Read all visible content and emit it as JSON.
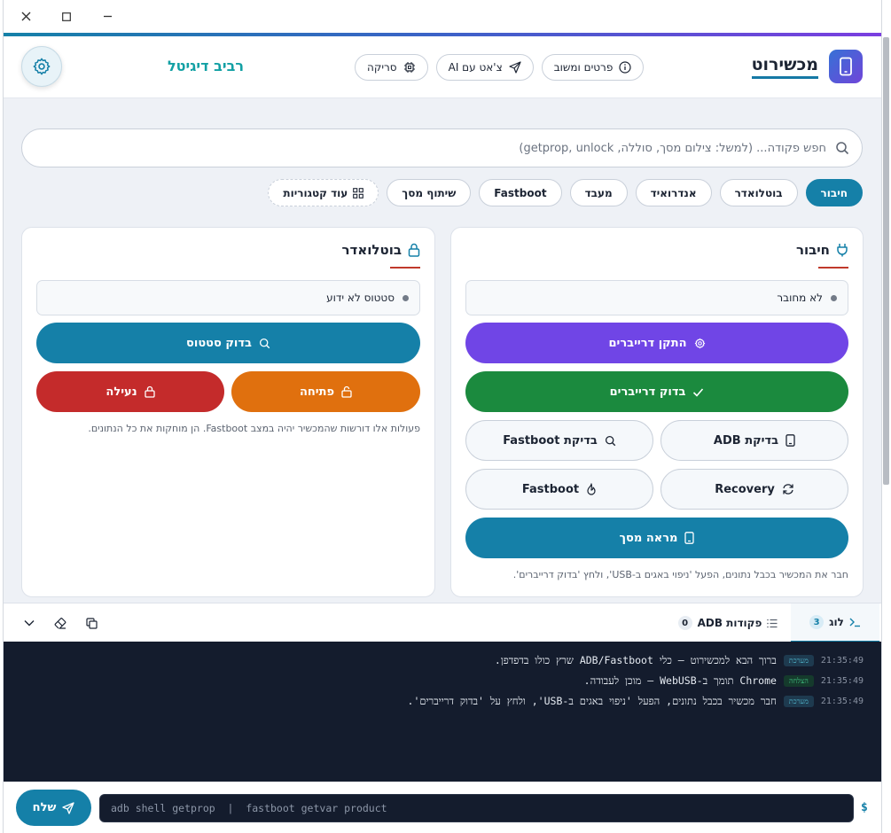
{
  "window": {
    "controls": {
      "close": "×",
      "maximize": "□",
      "minimize": "–"
    }
  },
  "header": {
    "brand_title": "מכשירוט",
    "subtitle": "רביב דיגיטל",
    "buttons": [
      {
        "label": "פרטים ומשוב",
        "icon": "info-icon"
      },
      {
        "label": "צ'אט עם AI",
        "icon": "send-icon"
      },
      {
        "label": "סריקה",
        "icon": "chip-icon"
      }
    ]
  },
  "search": {
    "placeholder": "חפש פקודה... (למשל: צילום מסך, סוללה, getprop, unlock)"
  },
  "categories": {
    "items": [
      "חיבור",
      "בוטלואדר",
      "אנדרואיד",
      "מעבד",
      "Fastboot",
      "שיתוף מסך"
    ],
    "active": "חיבור",
    "more_label": "עוד קטגוריות"
  },
  "connection_panel": {
    "title": "חיבור",
    "status": "לא מחובר",
    "install_drivers": "התקן דרייברים",
    "check_drivers": "בדוק דרייברים",
    "adb_check": "בדיקת ADB",
    "fastboot_check": "בדיקת Fastboot",
    "recovery": "Recovery",
    "fastboot": "Fastboot",
    "screen_mirror": "מראה מסך",
    "note": "חבר את המכשיר בכבל נתונים, הפעל 'ניפוי באגים ב-USB', ולחץ 'בדוק דרייברים'."
  },
  "bootloader_panel": {
    "title": "בוטלואדר",
    "status": "סטטוס לא ידוע",
    "check_status": "בדוק סטטוס",
    "unlock": "פתיחה",
    "lock": "נעילה",
    "note": "פעולות אלו דורשות שהמכשיר יהיה במצב Fastboot. הן מוחקות את כל הנתונים."
  },
  "terminal": {
    "log_tab": "לוג",
    "log_count": "3",
    "adb_tab": "פקודות ADB",
    "adb_count": "0",
    "lines": [
      {
        "time": "21:35:49",
        "tag": "מערכת",
        "tag_type": "system",
        "msg": "ברוך הבא למכשירוט — כלי ADB/Fastboot שרץ כולו בדפדפן."
      },
      {
        "time": "21:35:49",
        "tag": "הצלחה",
        "tag_type": "success",
        "msg": "Chrome תומך ב-WebUSB — מוכן לעבודה."
      },
      {
        "time": "21:35:49",
        "tag": "מערכת",
        "tag_type": "system",
        "msg": "חבר מכשיר בכבל נתונים, הפעל 'ניפוי באגים ב-USB', ולחץ על 'בדוק דרייברים'."
      }
    ],
    "input_placeholder": "adb shell getprop  |  fastboot getvar product",
    "send_label": "שלח",
    "prompt": "$"
  },
  "colors": {
    "accent": "#1580a8",
    "purple": "#7045e6",
    "green": "#1b8a3e",
    "orange": "#e0700e",
    "red": "#c42b2b",
    "terminal_bg": "#141c2d",
    "subtitle": "#12a0a4"
  }
}
